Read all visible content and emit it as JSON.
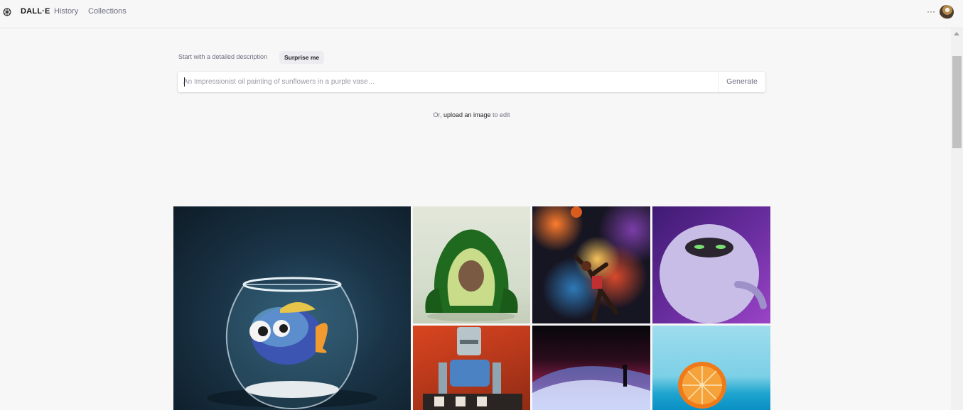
{
  "app": {
    "brand": "DALL·E",
    "nav": {
      "history": "History",
      "collections": "Collections"
    },
    "more_label": "···"
  },
  "prompt": {
    "hint": "Start with a detailed description",
    "surprise_label": "Surprise me",
    "placeholder": "An Impressionist oil painting of sunflowers in a purple vase…",
    "value": "",
    "generate_label": "Generate"
  },
  "upload": {
    "prefix": "Or, ",
    "link": "upload an image",
    "suffix": " to edit"
  },
  "gallery": {
    "tiles": [
      {
        "name": "fish-in-bowl"
      },
      {
        "name": "avocado-armchair"
      },
      {
        "name": "space-basketball"
      },
      {
        "name": "purple-monster"
      },
      {
        "name": "robot-painting"
      },
      {
        "name": "dunes-figure"
      },
      {
        "name": "orange-half"
      }
    ]
  },
  "colors": {
    "background": "#f7f7f8",
    "text": "#202123",
    "muted": "#6e6e80",
    "chip": "#ececf1"
  }
}
